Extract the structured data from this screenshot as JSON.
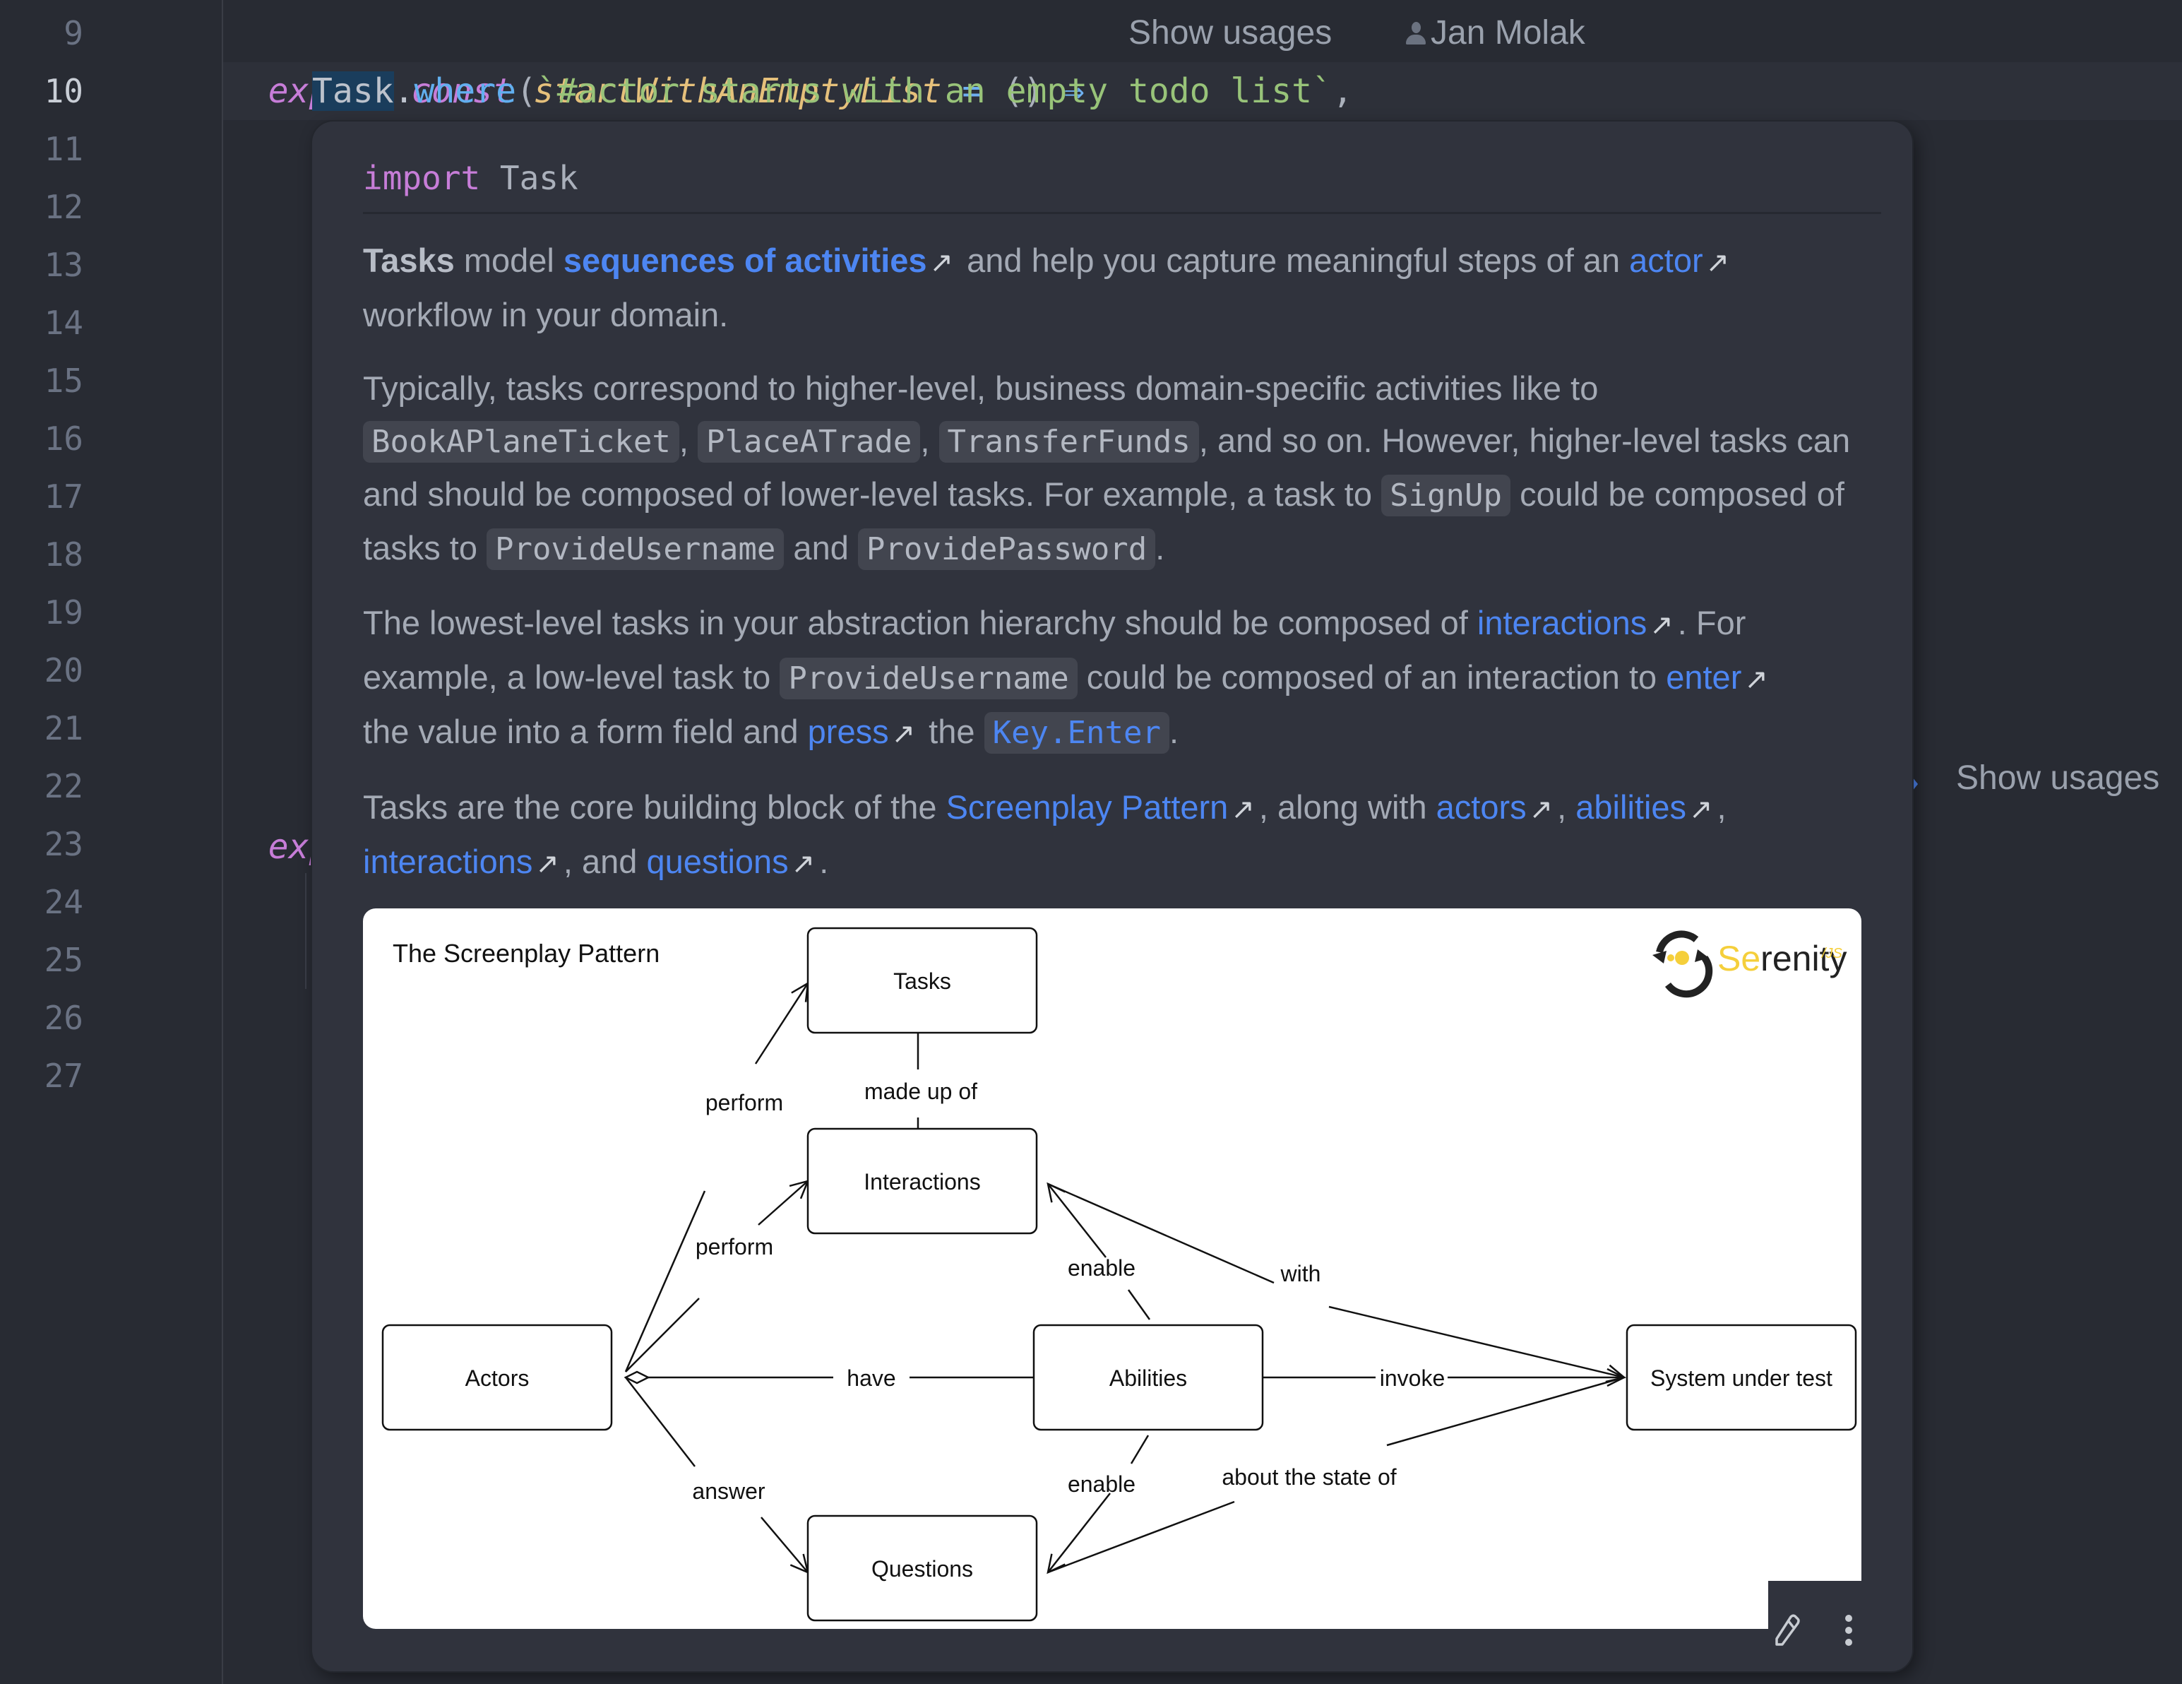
{
  "editor": {
    "line_numbers": [
      "9",
      "10",
      "11",
      "12",
      "13",
      "14",
      "15",
      "16",
      "17",
      "18",
      "19",
      "20",
      "21",
      "22",
      "23",
      "24",
      "25",
      "26",
      "27"
    ],
    "current_line": "10",
    "line9": {
      "kw1": "export",
      "kw2": "const",
      "name": "startWithAnEmptyList",
      "eq": "=",
      "parens": "()",
      "arrow": "⇒"
    },
    "line9_inlays": {
      "usages": "Show usages",
      "author": "Jan Molak"
    },
    "line10": {
      "selected": "Task",
      "dot": ".",
      "method": "where",
      "open": "(",
      "string": "`#actor starts with an empty todo list`",
      "comma": ","
    },
    "line22": {
      "partial": "expo"
    },
    "line22_inlay": {
      "usages": "Show usages"
    }
  },
  "popup": {
    "import_kw": "import",
    "import_name": "Task",
    "p1": {
      "bold": "Tasks",
      "t1": " model ",
      "link1": "sequences of activities",
      "t2": " and help you capture meaningful steps of an ",
      "link2": "actor",
      "t3": "workflow in your domain."
    },
    "p2": {
      "t1": "Typically, tasks correspond to higher-level, business domain-specific activities like to ",
      "c1": "BookAPlaneTicket",
      "sep1": ", ",
      "c2": "PlaceATrade",
      "sep2": ", ",
      "c3": "TransferFunds",
      "t2": ", and so on. However, higher-level tasks can and should be composed of lower-level tasks. For example, a task to ",
      "c4": "SignUp",
      "t3": " could be composed of tasks to ",
      "c5": "ProvideUsername",
      "t4": " and ",
      "c6": "ProvidePassword",
      "t5": "."
    },
    "p3": {
      "t1": "The lowest-level tasks in your abstraction hierarchy should be composed of ",
      "link1": "interactions",
      "t2": ". For example, a low-level task to ",
      "c1": "ProvideUsername",
      "t3": " could be composed of an interaction to ",
      "link2": "enter",
      "t4": "the value into a form field and ",
      "link3": "press",
      "t5": " the ",
      "c2": "Key.Enter",
      "t6": "."
    },
    "p4": {
      "t1": "Tasks are the core building block of the ",
      "link1": "Screenplay Pattern",
      "t2": ", along with ",
      "link2": "actors",
      "t3": ", ",
      "link3": "abilities",
      "t4": ", ",
      "link4": "interactions",
      "t5": ", and ",
      "link5": "questions",
      "t6": "."
    },
    "ext_glyph": "↗",
    "diagram": {
      "title": "The Screenplay Pattern",
      "logo": {
        "part1": "Se",
        "part2": "renity",
        "suffix": "/JS",
        "accent": "#f5cf3b"
      },
      "nodes": {
        "tasks": "Tasks",
        "interactions": "Interactions",
        "actors": "Actors",
        "abilities": "Abilities",
        "questions": "Questions",
        "sut": "System under test"
      },
      "edges": {
        "perform_tasks": "perform",
        "made_up_of": "made up of",
        "perform_interactions": "perform",
        "enable_interactions": "enable",
        "with": "with",
        "have": "have",
        "invoke": "invoke",
        "answer": "answer",
        "enable_questions": "enable",
        "about_state": "about the state of"
      }
    },
    "toolbar": {
      "edit": "edit-pencil",
      "more": "more-options"
    }
  },
  "colors": {
    "background": "#282b33",
    "popup": "#30333d",
    "link": "#4d86f2",
    "keyword": "#c77dd8",
    "function": "#e5c07b",
    "string": "#98c379"
  }
}
